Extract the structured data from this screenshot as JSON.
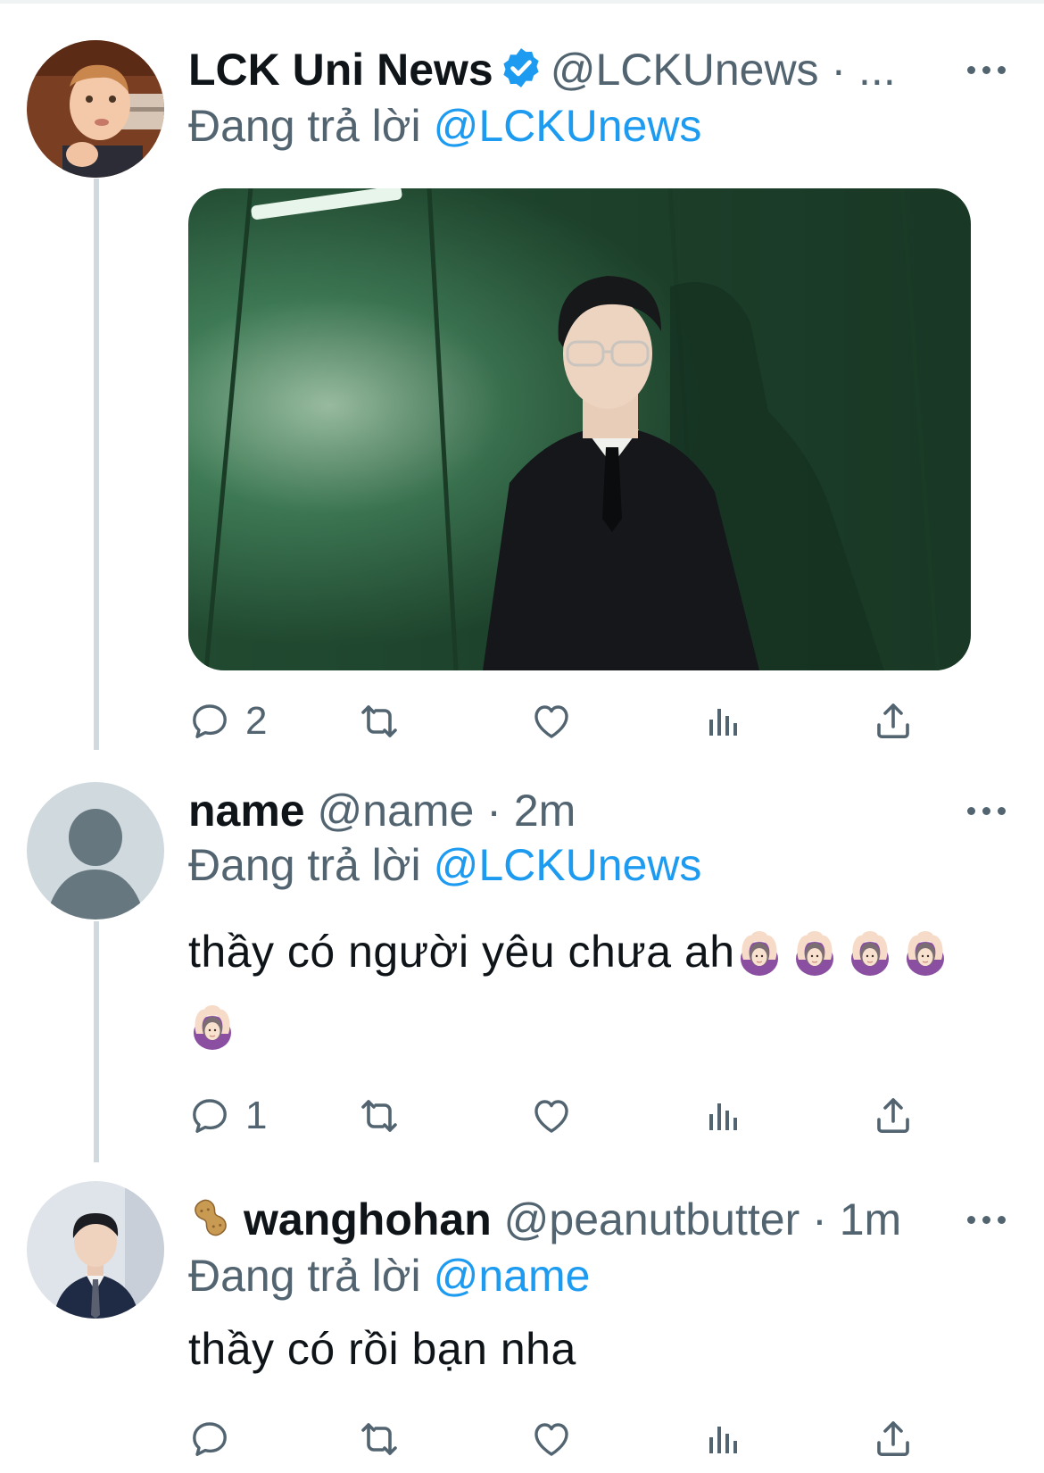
{
  "tweets": [
    {
      "display_name": "LCK Uni News",
      "handle": "@LCKUnews",
      "separator": "·",
      "time": "...",
      "verified": true,
      "replying_prefix": "Đang trả lời",
      "replying_to": "@LCKUnews",
      "text": "",
      "has_media": true,
      "reply_count": "2"
    },
    {
      "display_name": "name",
      "handle": "@name",
      "separator": "·",
      "time": "2m",
      "verified": false,
      "replying_prefix": "Đang trả lời",
      "replying_to": "@LCKUnews",
      "text": "thầy có người yêu chưa ah",
      "emoji": "🙆🏻‍♀️",
      "emoji_count": 5,
      "reply_count": "1"
    },
    {
      "display_name": "wanghohan",
      "name_emoji": "peanut-icon",
      "handle": "@peanutbutter",
      "separator": "·",
      "time": "1m",
      "verified": false,
      "replying_prefix": "Đang trả lời",
      "replying_to": "@name",
      "text": "thầy có rồi bạn nha",
      "reply_count": ""
    }
  ],
  "action_icons": [
    "reply-icon",
    "retweet-icon",
    "like-icon",
    "views-icon",
    "share-icon"
  ],
  "colors": {
    "accent": "#1d9bf0",
    "secondary_text": "#536471",
    "primary_text": "#0f1419",
    "thread_line": "#cfd9de",
    "media_bg": "#2c5a3c"
  }
}
